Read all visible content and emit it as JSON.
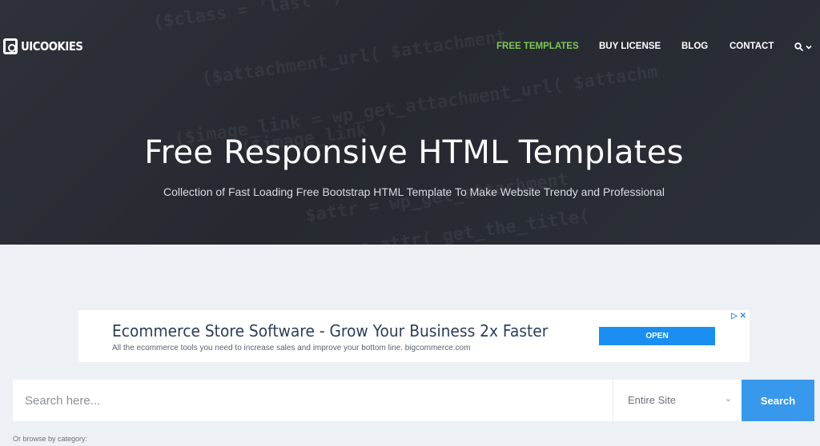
{
  "brand": {
    "name": "UICOOKIES"
  },
  "nav": {
    "items": [
      {
        "label": "FREE TEMPLATES",
        "active": true
      },
      {
        "label": "BUY LICENSE",
        "active": false
      },
      {
        "label": "BLOG",
        "active": false
      },
      {
        "label": "CONTACT",
        "active": false
      }
    ],
    "search_icon": "search-icon",
    "chevron_icon": "chevron-down-icon"
  },
  "hero": {
    "title": "Free Responsive HTML Templates",
    "subtitle": "Collection of Fast Loading Free Bootstrap HTML Template To Make Website Trendy and Professional",
    "background_code": [
      "($class = 'last' )",
      "($attachment_url( $attachment",
      "($image_link = wp_get_attachment_url( $attachm",
      "($image_link )",
      "$attr = wp_get_attachment",
      "esc_attr( get_the_title("
    ]
  },
  "ad": {
    "title": "Ecommerce Store Software - Grow Your Business 2x Faster",
    "description": "All the ecommerce tools you need to increase sales and improve your bottom line. bigcommerce.com",
    "button_label": "OPEN",
    "choices_label": "▷ ✕"
  },
  "search": {
    "placeholder": "Search here...",
    "scope_value": "Entire Site",
    "button_label": "Search"
  },
  "browse_label": "Or browse by category:",
  "colors": {
    "accent_green": "#7dc855",
    "search_blue": "#3899ec",
    "ad_blue": "#1a8ef1",
    "hero_dark": "#2a2d34",
    "page_bg": "#edf1f5"
  }
}
